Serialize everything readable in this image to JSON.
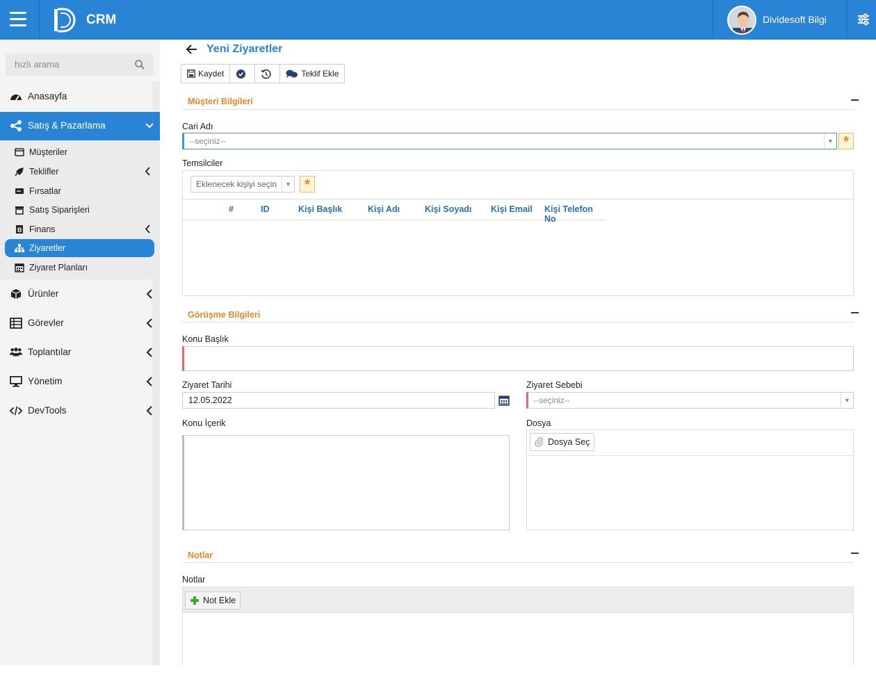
{
  "header": {
    "app_title": "CRM",
    "user_name": "Dividesoft Bilgi"
  },
  "sidebar": {
    "search_placeholder": "hızlı arama",
    "items": [
      {
        "label": "Anasayfa",
        "icon": "dashboard-icon"
      },
      {
        "label": "Satış & Pazarlama",
        "icon": "share-icon",
        "active": true
      },
      {
        "label": "Ürünler",
        "icon": "cube-icon"
      },
      {
        "label": "Görevler",
        "icon": "table-icon"
      },
      {
        "label": "Toplantılar",
        "icon": "users-icon"
      },
      {
        "label": "Yönetim",
        "icon": "monitor-icon"
      },
      {
        "label": "DevTools",
        "icon": "code-icon"
      }
    ],
    "sub_items": [
      {
        "label": "Müşteriler",
        "icon": "card-icon"
      },
      {
        "label": "Teklifler",
        "icon": "rocket-icon"
      },
      {
        "label": "Fırsatlar",
        "icon": "drive-icon"
      },
      {
        "label": "Satış Siparişleri",
        "icon": "store-icon"
      },
      {
        "label": "Finans",
        "icon": "bold-icon"
      },
      {
        "label": "Ziyaretler",
        "icon": "sitemap-icon",
        "active": true
      },
      {
        "label": "Ziyaret Planları",
        "icon": "calendar-icon"
      }
    ]
  },
  "page": {
    "title": "Yeni Ziyaretler",
    "toolbar": {
      "save": "Kaydet",
      "offer": "Teklif Ekle"
    }
  },
  "customer": {
    "section": "Müşteri Bilgileri",
    "cari_label": "Cari Adı",
    "cari_value": "--seçiniz--",
    "reps_label": "Temsilciler",
    "reps_placeholder": "Eklenecek kişiyi seçin",
    "columns": [
      "#",
      "ID",
      "Kişi Başlık",
      "Kişi Adı",
      "Kişi Soyadı",
      "Kişi Email",
      "Kişi Telefon No"
    ]
  },
  "meeting": {
    "section": "Görüşme Bilgileri",
    "subject_label": "Konu Başlık",
    "date_label": "Ziyaret Tarihi",
    "date_value": "12.05.2022",
    "reason_label": "Ziyaret Sebebi",
    "reason_value": "--seçiniz--",
    "content_label": "Konu İçerik",
    "file_label": "Dosya",
    "file_button": "Dosya Seç"
  },
  "notes": {
    "section": "Notlar",
    "label": "Notlar",
    "add_button": "Not Ekle"
  },
  "colors": {
    "accent": "#2a84d6",
    "section": "#e08a2b",
    "required": "#ee6666"
  }
}
